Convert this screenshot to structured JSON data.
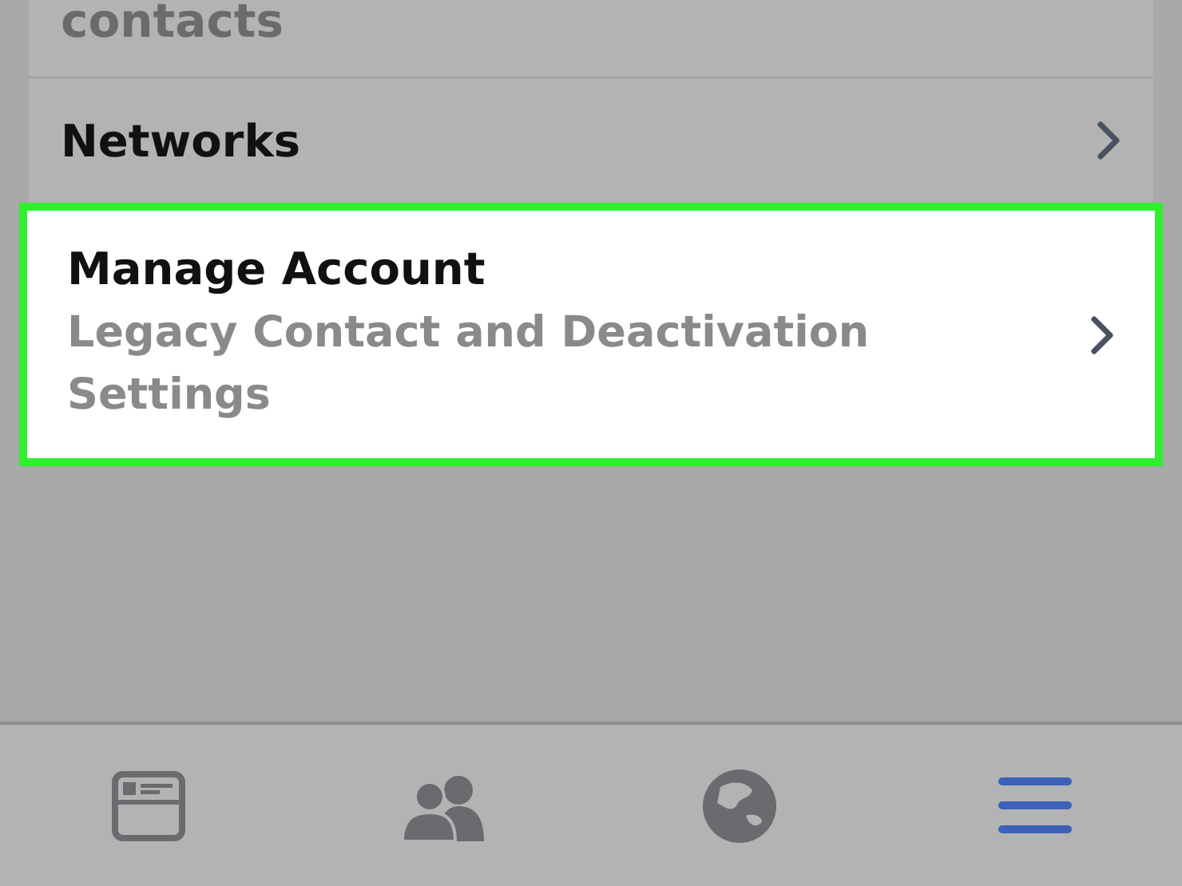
{
  "settings_list": [
    {
      "title": "contacts",
      "kind": "partial",
      "highlighted": false
    },
    {
      "title": "Networks",
      "kind": "plain",
      "highlighted": false
    },
    {
      "title": "Manage Account",
      "subtitle": "Legacy Contact and Deactivation Settings",
      "kind": "detail",
      "highlighted": true
    }
  ],
  "tab_bar": [
    {
      "kind": "feed",
      "selected": false
    },
    {
      "kind": "friends",
      "selected": false
    },
    {
      "kind": "globe",
      "selected": false
    },
    {
      "kind": "menu",
      "selected": true
    }
  ]
}
